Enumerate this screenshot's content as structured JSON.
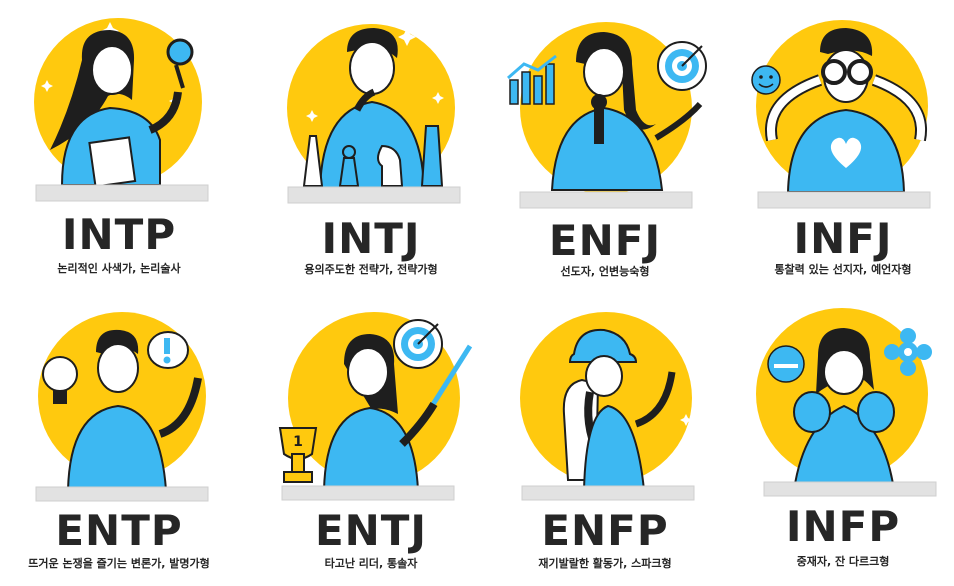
{
  "colors": {
    "circle": "#FFC90E",
    "figure": "#3DB8F2",
    "outline": "#1E1E1E",
    "desk": "#E2E2E2",
    "text": "#262626"
  },
  "cards": [
    {
      "type": "INTP",
      "subtitle": "논리적인 사색가, 논리술사"
    },
    {
      "type": "INTJ",
      "subtitle": "용의주도한 전략가, 전략가형"
    },
    {
      "type": "ENFJ",
      "subtitle": "선도자, 언변능숙형"
    },
    {
      "type": "INFJ",
      "subtitle": "통찰력 있는 선지자, 예언자형"
    },
    {
      "type": "ENTP",
      "subtitle": "뜨거운 논쟁을 즐기는 변론가, 발명가형"
    },
    {
      "type": "ENTJ",
      "subtitle": "타고난 리더, 통솔자"
    },
    {
      "type": "ENFP",
      "subtitle": "재기발랄한 활동가, 스파크형"
    },
    {
      "type": "INFP",
      "subtitle": "중재자, 잔 다르크형"
    }
  ],
  "trophy_number": "1"
}
